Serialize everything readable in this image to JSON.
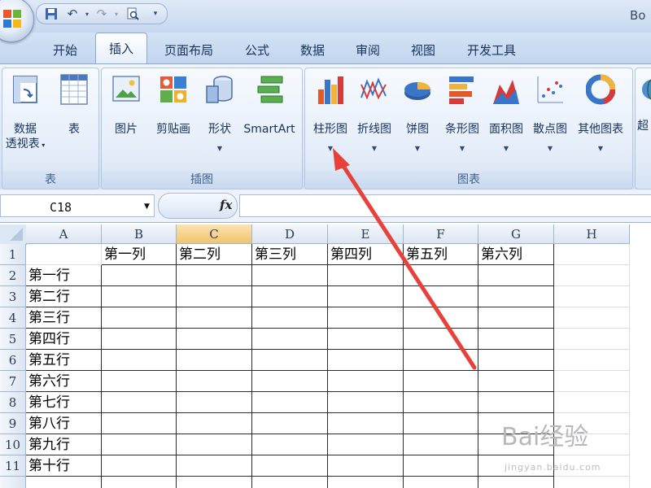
{
  "window": {
    "title": "Bo"
  },
  "quick_access": {
    "icons": [
      "save-icon",
      "undo-icon",
      "redo-icon",
      "print-preview-icon",
      "customize-icon"
    ]
  },
  "tabs": [
    {
      "label": "开始",
      "active": false
    },
    {
      "label": "插入",
      "active": true
    },
    {
      "label": "页面布局",
      "active": false
    },
    {
      "label": "公式",
      "active": false
    },
    {
      "label": "数据",
      "active": false
    },
    {
      "label": "审阅",
      "active": false
    },
    {
      "label": "视图",
      "active": false
    },
    {
      "label": "开发工具",
      "active": false
    }
  ],
  "ribbon": {
    "groups": {
      "tables": {
        "label": "表",
        "pivot_line1": "数据",
        "pivot_line2": "透视表",
        "table": "表"
      },
      "illustrations": {
        "label": "插图",
        "picture": "图片",
        "clipart": "剪贴画",
        "shapes": "形状",
        "smartart": "SmartArt"
      },
      "charts": {
        "label": "图表",
        "column": "柱形图",
        "line": "折线图",
        "pie": "饼图",
        "bar": "条形图",
        "area": "面积图",
        "scatter": "散点图",
        "other": "其他图表"
      },
      "links": {
        "partial_label": "超"
      }
    }
  },
  "formula_bar": {
    "name_box": "C18",
    "fx_label": "fx",
    "value": ""
  },
  "sheet": {
    "selected_column": "C",
    "columns": [
      "A",
      "B",
      "C",
      "D",
      "E",
      "F",
      "G",
      "H"
    ],
    "rows": [
      "1",
      "2",
      "3",
      "4",
      "5",
      "6",
      "7",
      "8",
      "9",
      "10",
      "11"
    ],
    "header_row": [
      "",
      "第一列",
      "第二列",
      "第三列",
      "第四列",
      "第五列",
      "第六列",
      ""
    ],
    "row_labels": [
      "",
      "第一行",
      "第二行",
      "第三行",
      "第四行",
      "第五行",
      "第六行",
      "第七行",
      "第八行",
      "第九行",
      "第十行"
    ]
  },
  "watermark": {
    "text": "Bai经验",
    "sub": "jingyan.baidu.com"
  },
  "colors": {
    "accent": "#e8403a",
    "selected_header": "#f2c46e",
    "ribbon": "#dde8f6"
  }
}
